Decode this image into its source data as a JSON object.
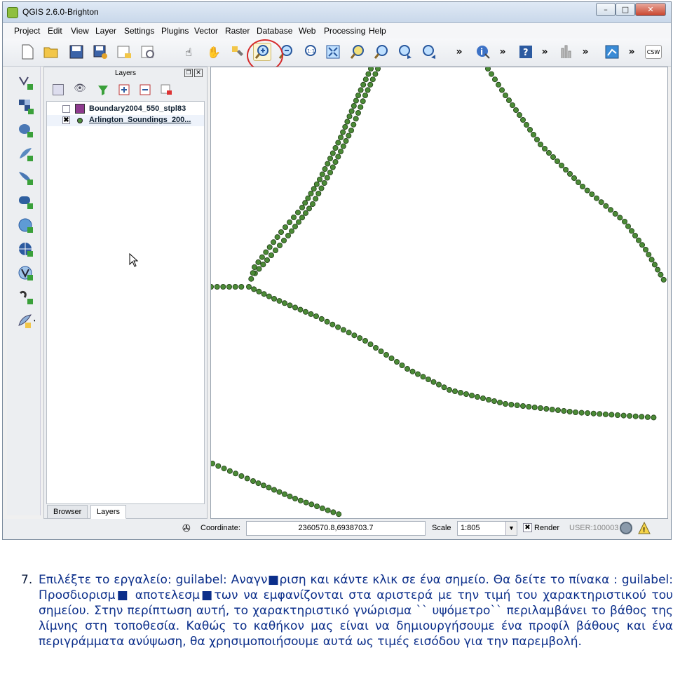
{
  "window": {
    "title": "QGIS 2.6.0-Brighton",
    "controls": [
      "–",
      "□",
      "✕"
    ]
  },
  "menu": [
    "Project",
    "Edit",
    "View",
    "Layer",
    "Settings",
    "Plugins",
    "Vector",
    "Raster",
    "Database",
    "Web",
    "Processing",
    "Help"
  ],
  "toolbar": {
    "overflow": "»",
    "csw": "CSW"
  },
  "layers_panel": {
    "title": "Layers",
    "layers": [
      {
        "name": "Boundary2004_550_stpl83",
        "checked": false,
        "symbol_color": "#8e3b8e"
      },
      {
        "name": "Arlington_Soundings_200...",
        "checked": true,
        "symbol_color": "#4f8f3f"
      }
    ],
    "tabs": [
      "Browser",
      "Layers"
    ],
    "active_tab": "Layers"
  },
  "map": {
    "point_color": "#4b8a36",
    "point_outline": "#1f3d16"
  },
  "statusbar": {
    "coordinate_label": "Coordinate:",
    "coordinate_value": "2360570.8,6938703.7",
    "scale_label": "Scale",
    "scale_value": "1:805",
    "render_label": "Render",
    "render_checked": true,
    "crs": "USER:100003"
  },
  "caption": {
    "number": "7.",
    "text": "Επιλέξτε το εργαλείο: guilabel: Αναγν■ριση και κάντε κλικ σε ένα σημείο. Θα δείτε το πίνακα : guilabel: Προσδιορισμ■ αποτελεσμ■των να εμφανίζονται στα αριστερά με την τιμή του χαρακτηριστικού του σημείου. Στην περίπτωση αυτή, το χαρακτηριστικό γνώρισμα `` υψόμετρο`` περιλαμβάνει το βάθος της λίμνης στη τοποθεσία. Καθώς το καθήκον μας είναι να δημιουργήσουμε ένα προφίλ βάθους και ένα περιγράμματα ανύψωση, θα χρησιμοποιήσουμε αυτά ως τιμές εισόδου για την παρεμβολή."
  }
}
